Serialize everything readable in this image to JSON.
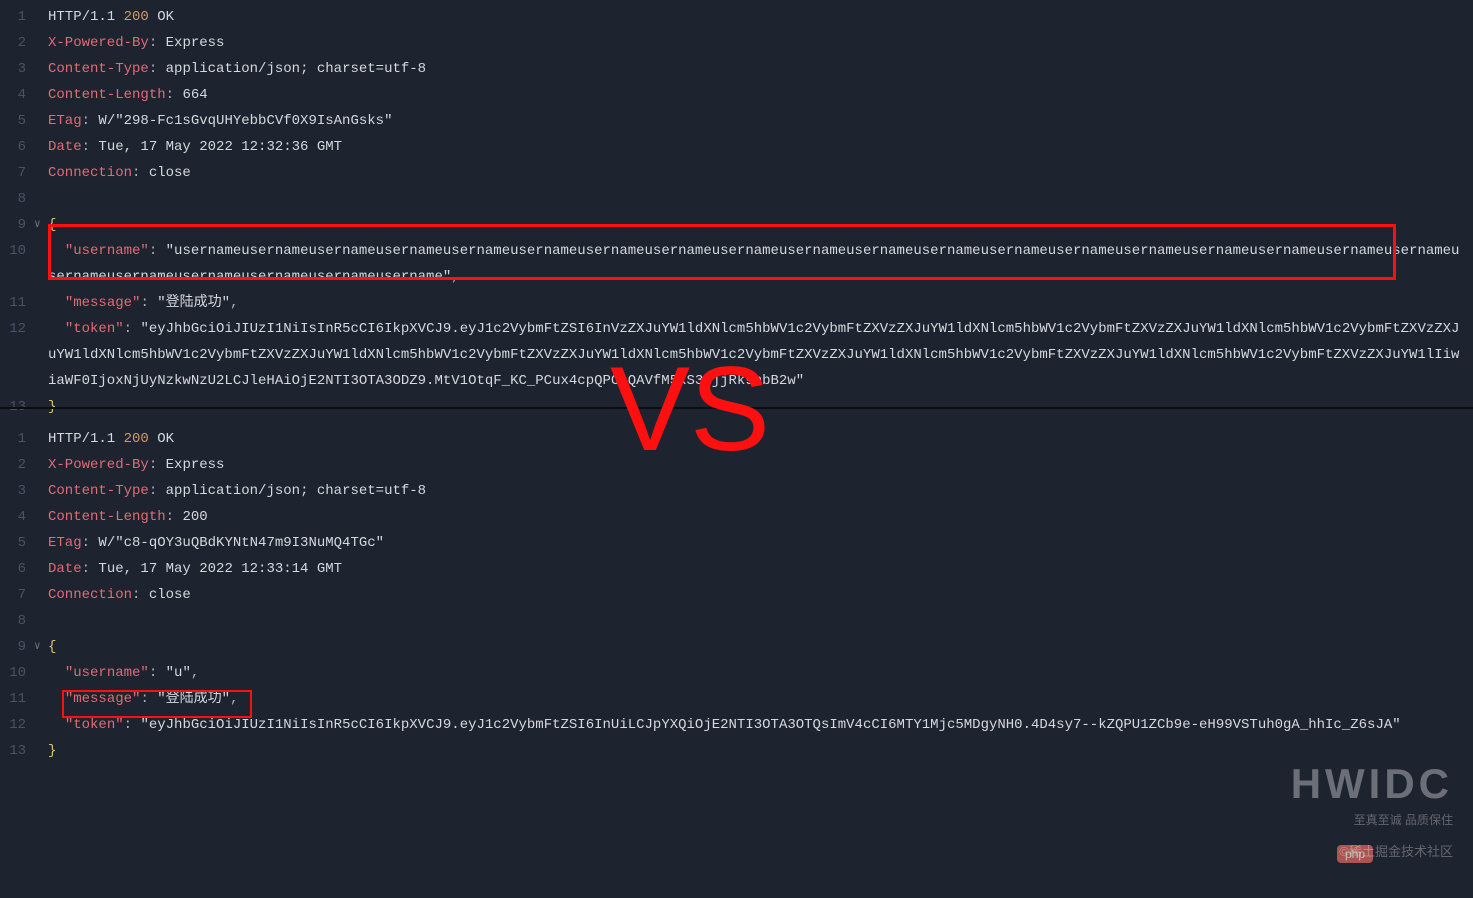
{
  "top": {
    "l1a": "HTTP/1.1 ",
    "l1b": "200 ",
    "l1c": "OK",
    "l2a": "X-Powered-By",
    "l2b": ": ",
    "l2c": "Express",
    "l3a": "Content-Type",
    "l3b": ": ",
    "l3c": "application/json; charset=utf-8",
    "l4a": "Content-Length",
    "l4b": ": ",
    "l4c": "664",
    "l5a": "ETag",
    "l5b": ": ",
    "l5c": "W/\"298-Fc1sGvqUHYebbCVf0X9IsAnGsks\"",
    "l6a": "Date",
    "l6b": ": ",
    "l6c": "Tue, 17 May 2022 12:32:36 GMT",
    "l7a": "Connection",
    "l7b": ": ",
    "l7c": "close",
    "brace_open": "{",
    "key_user": "\"username\"",
    "colon_user": ": ",
    "val_user": "\"usernameusernameusernameusernameusernameusernameusernameusernameusernameusernameusernameusernameusernameusernameusernameusernameusernameusernameusernameusernameusernameusernameusernameusernameusername\"",
    "comma1": ",",
    "key_msg": "\"message\"",
    "colon_msg": ": ",
    "val_msg": "\"登陆成功\"",
    "comma2": ",",
    "key_tok": "\"token\"",
    "colon_tok": ": ",
    "val_tok": "\"eyJhbGciOiJIUzI1NiIsInR5cCI6IkpXVCJ9.eyJ1c2VybmFtZSI6InVzZXJuYW1ldXNlcm5hbWV1c2VybmFtZXVzZXJuYW1ldXNlcm5hbWV1c2VybmFtZXVzZXJuYW1ldXNlcm5hbWV1c2VybmFtZXVzZXJuYW1ldXNlcm5hbWV1c2VybmFtZXVzZXJuYW1ldXNlcm5hbWV1c2VybmFtZXVzZXJuYW1ldXNlcm5hbWV1c2VybmFtZXVzZXJuYW1ldXNlcm5hbWV1c2VybmFtZXVzZXJuYW1ldXNlcm5hbWV1c2VybmFtZXVzZXJuYW1lIiwiaWF0IjoxNjUyNzkwNzU2LCJleHAiOjE2NTI3OTA3ODZ9.MtV1OtqF_KC_PCux4cpQPC_QAVfM5xS3LjjRk9nbB2w\"",
    "brace_close": "}"
  },
  "bottom": {
    "l1a": "HTTP/1.1 ",
    "l1b": "200 ",
    "l1c": "OK",
    "l2a": "X-Powered-By",
    "l2b": ": ",
    "l2c": "Express",
    "l3a": "Content-Type",
    "l3b": ": ",
    "l3c": "application/json; charset=utf-8",
    "l4a": "Content-Length",
    "l4b": ": ",
    "l4c": "200",
    "l5a": "ETag",
    "l5b": ": ",
    "l5c": "W/\"c8-qOY3uQBdKYNtN47m9I3NuMQ4TGc\"",
    "l6a": "Date",
    "l6b": ": ",
    "l6c": "Tue, 17 May 2022 12:33:14 GMT",
    "l7a": "Connection",
    "l7b": ": ",
    "l7c": "close",
    "brace_open": "{",
    "key_user": "\"username\"",
    "colon_user": ": ",
    "val_user": "\"u\"",
    "comma1": ",",
    "key_msg": "\"message\"",
    "colon_msg": ": ",
    "val_msg": "\"登陆成功\"",
    "comma2": ",",
    "key_tok": "\"token\"",
    "colon_tok": ": ",
    "val_tok": "\"eyJhbGciOiJIUzI1NiIsInR5cCI6IkpXVCJ9.eyJ1c2VybmFtZSI6InUiLCJpYXQiOjE2NTI3OTA3OTQsImV4cCI6MTY1Mjc5MDgyNH0.4D4sy7--kZQPU1ZCb9e-eH99VSTuh0gA_hhIc_Z6sJA\"",
    "brace_close": "}"
  },
  "nums_top": [
    "1",
    "2",
    "3",
    "4",
    "5",
    "6",
    "7",
    "8",
    "9",
    "10",
    "11",
    "12",
    "13"
  ],
  "nums_bottom": [
    "1",
    "2",
    "3",
    "4",
    "5",
    "6",
    "7",
    "8",
    "9",
    "10",
    "11",
    "12",
    "13"
  ],
  "vs": "VS",
  "wm1": "HWIDC",
  "wm2": "至真至诚 品质保住",
  "wm3": "©稀土掘金技术社区",
  "badge": "php"
}
